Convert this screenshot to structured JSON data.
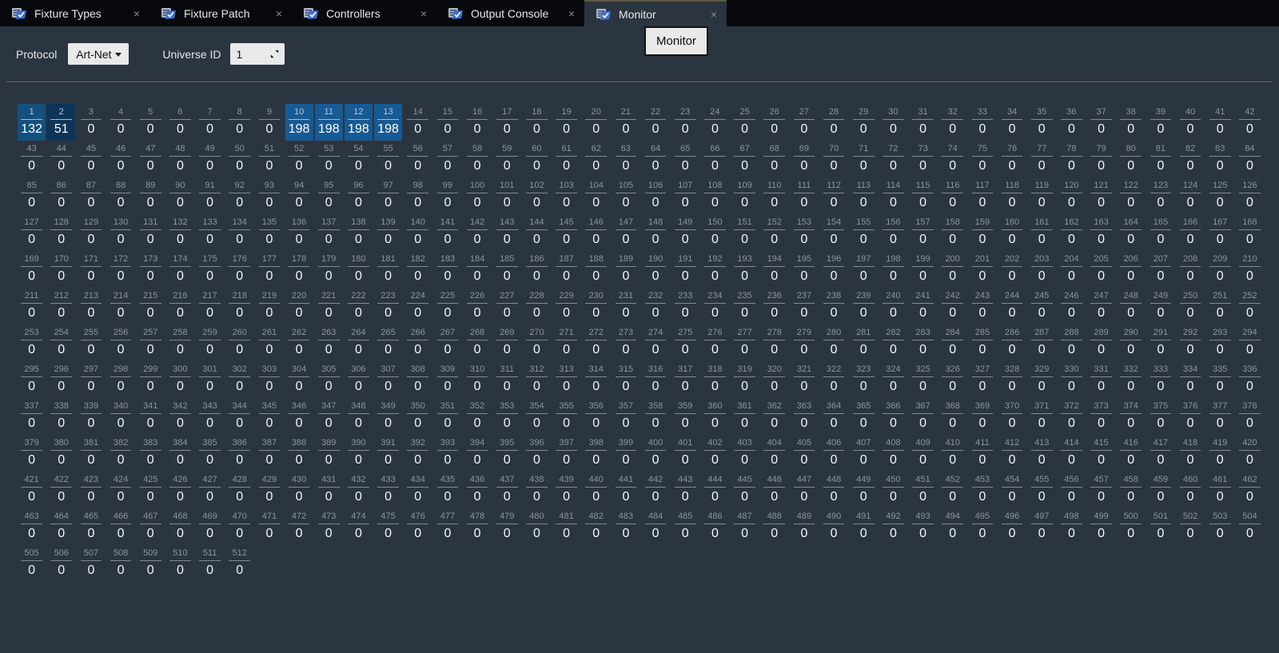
{
  "tabs": [
    {
      "label": "Fixture Types",
      "active": false
    },
    {
      "label": "Fixture Patch",
      "active": false
    },
    {
      "label": "Controllers",
      "active": false
    },
    {
      "label": "Output Console",
      "active": false
    },
    {
      "label": "Monitor",
      "active": true
    }
  ],
  "tab_close_glyph": "×",
  "tooltip": {
    "text": "Monitor"
  },
  "toolbar": {
    "protocol_label": "Protocol",
    "protocol_value": "Art-Net",
    "universe_label": "Universe ID",
    "universe_value": "1"
  },
  "dmx_grid": {
    "channel_count": 512,
    "channels_per_row": 42,
    "default_value": 0,
    "values": {
      "1": 132,
      "2": 51,
      "10": 198,
      "11": 198,
      "12": 198,
      "13": 198
    },
    "highlight_colors": {
      "1": "#14517f",
      "2": "#0d3459",
      "10": "#175a94",
      "11": "#175a94",
      "12": "#175a94",
      "13": "#175a94"
    }
  },
  "colors": {
    "content_bg": "#2b3540",
    "tabbar_bg": "#07090d",
    "control_bg": "#e9e9e9",
    "control_text": "#111111",
    "text": "#e3e8ec",
    "channel_number": "#8d959d",
    "value_text": "#f2f5f7",
    "separator_light": "#666d74",
    "active_tab_accent": "#5e5b44",
    "tooltip_bg": "#e9e9e9",
    "tooltip_border": "#141414"
  }
}
